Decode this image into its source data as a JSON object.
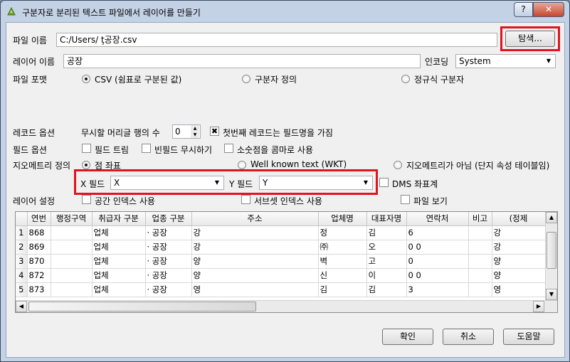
{
  "window": {
    "title": "구분자로 분리된 텍스트 파일에서 레이어를 만들기",
    "help_label": "?",
    "close_label": "✕"
  },
  "file_name": {
    "label": "파일 이름",
    "value": "C:/Users/                                                                               ţ공장.csv",
    "browse_label": "탐색..."
  },
  "layer_name": {
    "label": "레이어 이름",
    "value": "            공장"
  },
  "encoding": {
    "label": "인코딩",
    "value": "System"
  },
  "file_format": {
    "label": "파일 포맷",
    "options": [
      "CSV (쉼표로 구분된 값)",
      "구분자 정의",
      "정규식 구분자"
    ],
    "selected": 0
  },
  "record_options": {
    "label": "레코드 옵션",
    "skip_label": "무시할 머리글 행의 수",
    "skip_value": "0",
    "first_record_label": "첫번째 레코드는 필드명을 가짐",
    "first_record_checked": true
  },
  "field_options": {
    "label": "필드 옵션",
    "trim_label": "필드 트림",
    "skip_empty_label": "빈필드 무시하기",
    "decimal_comma_label": "소숫점을 콤마로 사용"
  },
  "geometry": {
    "label": "지오메트리 정의",
    "options": [
      "점 좌표",
      "Well known text (WKT)",
      "지오메트리가 아님 (단지 속성 테이블임)"
    ],
    "selected": 0,
    "x_field_label": "X 필드",
    "x_field_value": "X",
    "y_field_label": "Y 필드",
    "y_field_value": "Y",
    "dms_label": "DMS 좌표계"
  },
  "layer_settings": {
    "label": "레이어 설정",
    "spatial_index_label": "공간 인덱스 사용",
    "subset_index_label": "서브셋 인덱스 사용",
    "watch_file_label": "파일 보기"
  },
  "table": {
    "columns": [
      "연번",
      "행정구역",
      "취급자 구분",
      "업종 구분",
      "주소",
      "업체명",
      "대표자명",
      "연락처",
      "비고",
      "(정제"
    ],
    "rows": [
      {
        "num": "1",
        "cells": [
          "868",
          "",
          "업체",
          "·      공장",
          "강",
          "정 ",
          "김",
          "6",
          "",
          "강"
        ]
      },
      {
        "num": "2",
        "cells": [
          "869",
          "",
          "업체",
          "·      공장",
          "강",
          "㈜",
          "오",
          "0                          0",
          "",
          "강"
        ]
      },
      {
        "num": "3",
        "cells": [
          "870",
          "",
          "업체",
          "·      공장",
          "양",
          "벽",
          "고",
          "0",
          "",
          "양"
        ]
      },
      {
        "num": "4",
        "cells": [
          "872",
          "",
          "업체",
          "·      공장",
          "양",
          "신",
          "이",
          "0                          0",
          "",
          "양"
        ]
      },
      {
        "num": "5",
        "cells": [
          "873",
          "",
          "업체",
          "·      공장",
          "영",
          "김",
          "김",
          "3",
          "",
          "영"
        ]
      }
    ]
  },
  "buttons": {
    "ok": "확인",
    "cancel": "취소",
    "help": "도움말"
  },
  "colors": {
    "highlight": "#e0141c",
    "frame": "#c4d2e6"
  }
}
